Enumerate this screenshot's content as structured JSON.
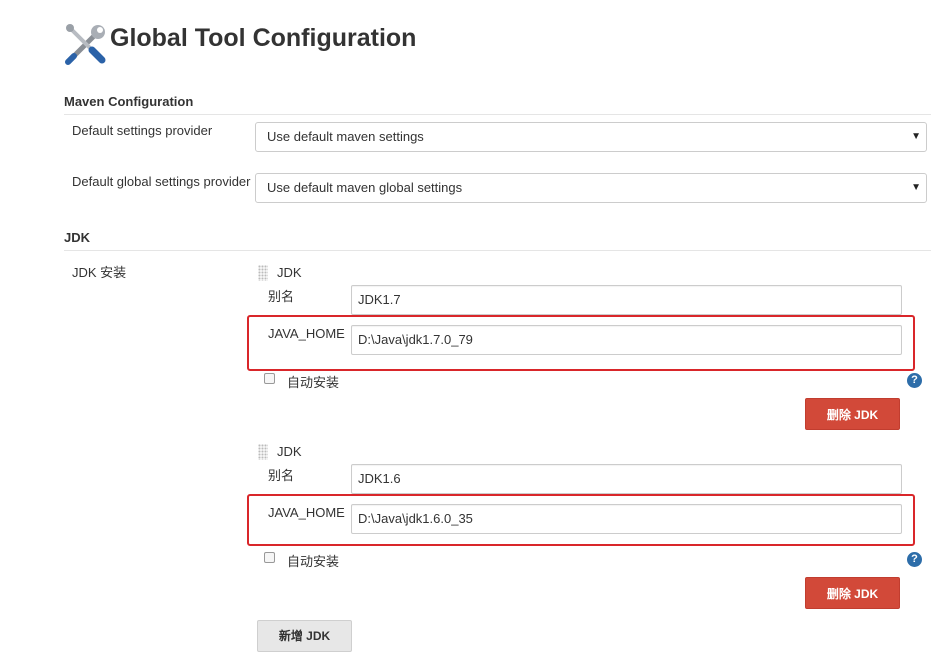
{
  "header": {
    "title": "Global Tool Configuration",
    "icon": "tools-icon"
  },
  "maven": {
    "section_title": "Maven Configuration",
    "settings_label": "Default settings provider",
    "settings_value": "Use default maven settings",
    "global_label": "Default global settings provider",
    "global_value": "Use default maven global settings"
  },
  "jdk": {
    "section_title": "JDK",
    "install_label": "JDK 安装",
    "entries": [
      {
        "header": "JDK",
        "alias_label": "别名",
        "alias_value": "JDK1.7",
        "home_label": "JAVA_HOME",
        "home_value": "D:\\Java\\jdk1.7.0_79",
        "auto_label": "自动安装",
        "delete_label": "删除 JDK"
      },
      {
        "header": "JDK",
        "alias_label": "别名",
        "alias_value": "JDK1.6",
        "home_label": "JAVA_HOME",
        "home_value": "D:\\Java\\jdk1.6.0_35",
        "auto_label": "自动安装",
        "delete_label": "删除 JDK"
      }
    ],
    "add_label": "新增 JDK",
    "help_symbol": "?"
  },
  "colors": {
    "highlight": "#d9262a",
    "delete_button": "#d24939",
    "help": "#2d6da9"
  }
}
